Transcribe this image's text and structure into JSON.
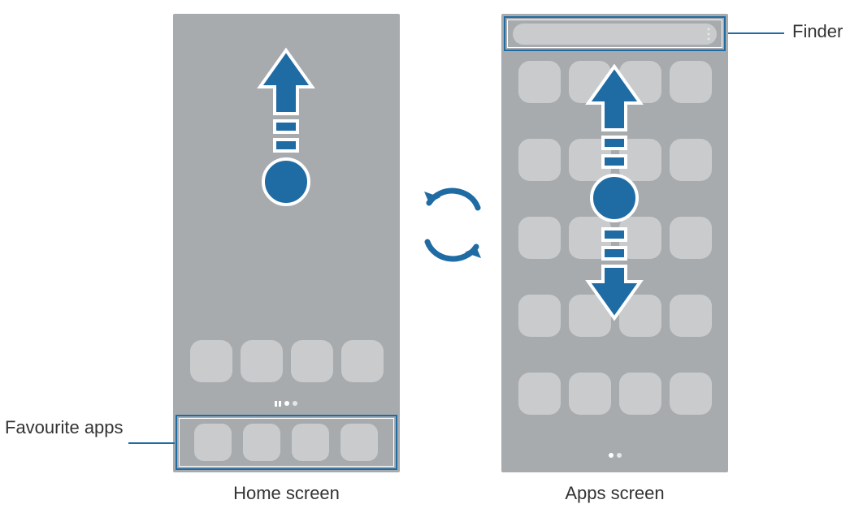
{
  "labels": {
    "favourite_apps": "Favourite apps",
    "finder": "Finder",
    "home_screen": "Home screen",
    "apps_screen": "Apps screen"
  }
}
